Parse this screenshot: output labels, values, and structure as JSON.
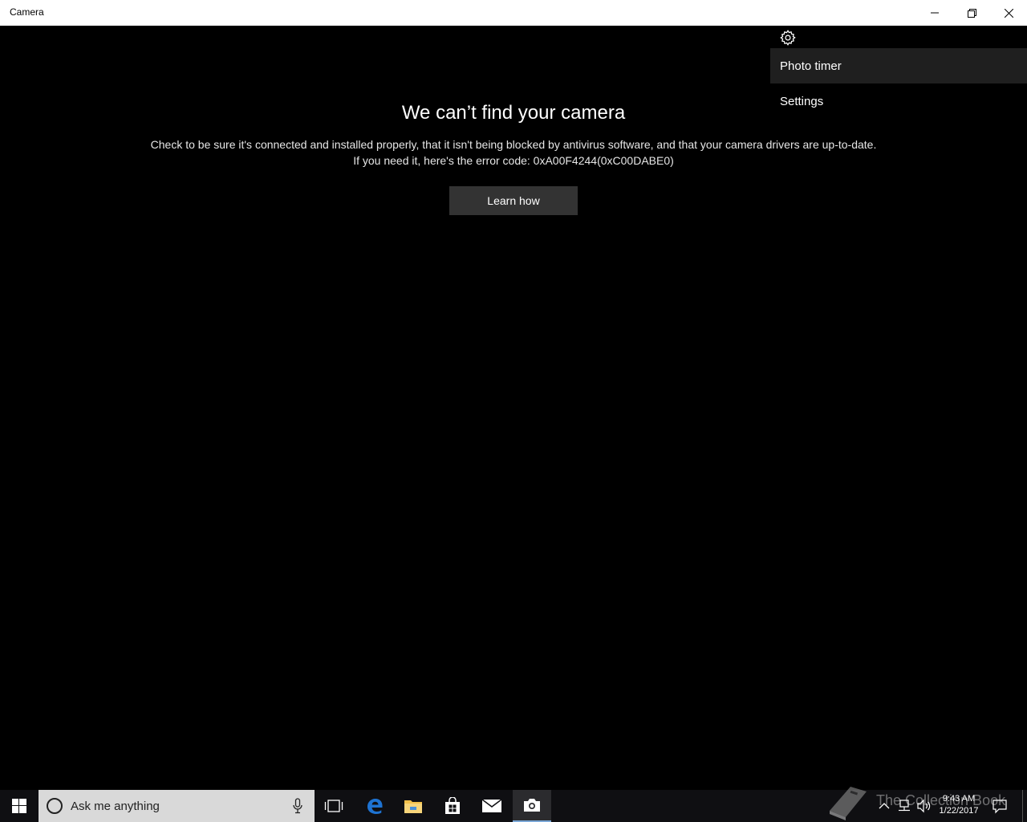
{
  "window": {
    "title": "Camera"
  },
  "error": {
    "heading": "We can’t find your camera",
    "line1": "Check to be sure it's connected and installed properly, that it isn't being blocked by antivirus software, and that your camera drivers are up-to-date.",
    "line2": "If you need it, here's the error code: 0xA00F4244(0xC00DABE0)",
    "button_label": "Learn how"
  },
  "flyout": {
    "items": [
      {
        "label": "Photo timer"
      },
      {
        "label": "Settings"
      }
    ]
  },
  "taskbar": {
    "search_placeholder": "Ask me anything",
    "watermark": "The Collection Book",
    "clock": {
      "time": "9:43 AM",
      "date": "1/22/2017"
    }
  },
  "colors": {
    "app_background": "#000000",
    "button_background": "#333333",
    "taskbar_background": "#0f0f12",
    "search_background": "#d9d9d9",
    "edge_blue": "#1e73d2",
    "explorer_yellow": "#f3c14b",
    "active_underline": "#7aa7d6"
  }
}
